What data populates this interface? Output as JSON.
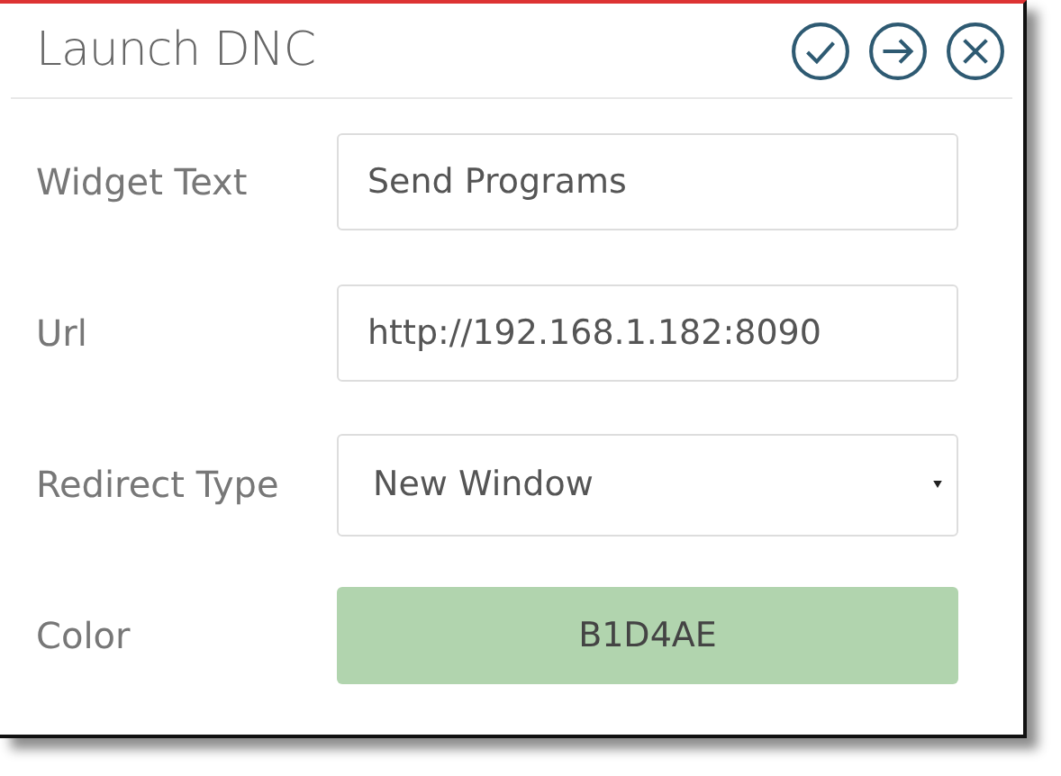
{
  "window": {
    "title": "Launch DNC"
  },
  "fields": [
    {
      "label": "Widget Text",
      "kind": "text",
      "value": "Send Programs"
    },
    {
      "label": "Url",
      "kind": "text",
      "value": "http://192.168.1.182:8090"
    },
    {
      "label": "Redirect Type",
      "kind": "select",
      "value": "New Window"
    },
    {
      "label": "Color",
      "kind": "color",
      "value": "B1D4AE",
      "color": "#b1d4ae"
    }
  ]
}
